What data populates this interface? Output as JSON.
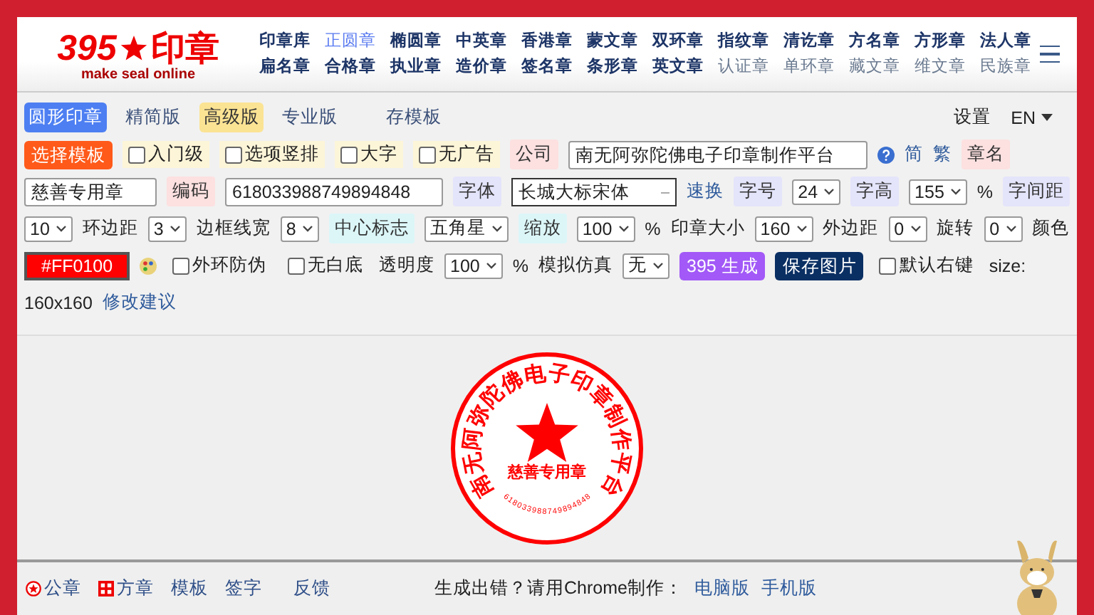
{
  "logo": {
    "number": "395",
    "title": "印章",
    "subtitle": "make seal online"
  },
  "nav": [
    [
      {
        "label": "印章库",
        "selected": false,
        "dimmed": false
      },
      {
        "label": "正圆章",
        "selected": true,
        "dimmed": false
      },
      {
        "label": "椭圆章",
        "selected": false,
        "dimmed": false
      },
      {
        "label": "中英章",
        "selected": false,
        "dimmed": false
      },
      {
        "label": "香港章",
        "selected": false,
        "dimmed": false
      },
      {
        "label": "蒙文章",
        "selected": false,
        "dimmed": false
      },
      {
        "label": "双环章",
        "selected": false,
        "dimmed": false
      },
      {
        "label": "指纹章",
        "selected": false,
        "dimmed": false
      },
      {
        "label": "清讫章",
        "selected": false,
        "dimmed": false
      },
      {
        "label": "方名章",
        "selected": false,
        "dimmed": false
      },
      {
        "label": "方形章",
        "selected": false,
        "dimmed": false
      },
      {
        "label": "法人章",
        "selected": false,
        "dimmed": false
      }
    ],
    [
      {
        "label": "扁名章",
        "selected": false,
        "dimmed": false
      },
      {
        "label": "合格章",
        "selected": false,
        "dimmed": false
      },
      {
        "label": "执业章",
        "selected": false,
        "dimmed": false
      },
      {
        "label": "造价章",
        "selected": false,
        "dimmed": false
      },
      {
        "label": "签名章",
        "selected": false,
        "dimmed": false
      },
      {
        "label": "条形章",
        "selected": false,
        "dimmed": false
      },
      {
        "label": "英文章",
        "selected": false,
        "dimmed": false
      },
      {
        "label": "认证章",
        "selected": false,
        "dimmed": true
      },
      {
        "label": "单环章",
        "selected": false,
        "dimmed": true
      },
      {
        "label": "藏文章",
        "selected": false,
        "dimmed": true
      },
      {
        "label": "维文章",
        "selected": false,
        "dimmed": true
      },
      {
        "label": "民族章",
        "selected": false,
        "dimmed": true
      }
    ]
  ],
  "modes": [
    {
      "label": "圆形印章",
      "kind": "active"
    },
    {
      "label": "精简版",
      "kind": "plain"
    },
    {
      "label": "高级版",
      "kind": "highlight"
    },
    {
      "label": "专业版",
      "kind": "plain"
    },
    {
      "label": "存模板",
      "kind": "plain"
    }
  ],
  "settings": "设置",
  "language": "EN",
  "rows": [
    [
      {
        "kind": "button",
        "label": "选择模板",
        "color": "#ff5a1a"
      },
      {
        "kind": "check",
        "label": "入门级",
        "checked": false
      },
      {
        "kind": "check",
        "label": "选项竖排",
        "checked": false
      },
      {
        "kind": "check",
        "label": "大字",
        "checked": false
      },
      {
        "kind": "check",
        "label": "无广告",
        "checked": false
      },
      {
        "kind": "tag",
        "label": "公司",
        "color": "#fde0e0"
      },
      {
        "kind": "input",
        "value": "南无阿弥陀佛电子印章制作平台"
      },
      {
        "kind": "help"
      },
      {
        "kind": "link",
        "label": "简"
      },
      {
        "kind": "link",
        "label": "繁"
      },
      {
        "kind": "tag",
        "label": "章名",
        "color": "#fde0e0"
      }
    ],
    [
      {
        "kind": "input",
        "value": "慈善专用章"
      },
      {
        "kind": "tag",
        "label": "编码",
        "color": "#fde0e0"
      },
      {
        "kind": "input",
        "value": "618033988749894848"
      },
      {
        "kind": "tag",
        "label": "字体",
        "color": "#e4e4fb"
      },
      {
        "kind": "combo",
        "value": "长城大标宋体"
      },
      {
        "kind": "link",
        "label": "速换"
      },
      {
        "kind": "tag",
        "label": "字号",
        "color": "#e4e4fb"
      },
      {
        "kind": "select",
        "value": "24"
      },
      {
        "kind": "tag",
        "label": "字高",
        "color": "#e4e4fb"
      },
      {
        "kind": "select",
        "value": "155"
      },
      {
        "kind": "text",
        "label": "%"
      },
      {
        "kind": "tag",
        "label": "字间距",
        "color": "#e4e4fb"
      }
    ],
    [
      {
        "kind": "select",
        "value": "10"
      },
      {
        "kind": "text",
        "label": "环边距"
      },
      {
        "kind": "select",
        "value": "3"
      },
      {
        "kind": "text",
        "label": "边框线宽"
      },
      {
        "kind": "select",
        "value": "8"
      },
      {
        "kind": "tag",
        "label": "中心标志",
        "color": "#dcf6f8"
      },
      {
        "kind": "select",
        "value": "五角星"
      },
      {
        "kind": "tag",
        "label": "缩放",
        "color": "#dcf6f8"
      },
      {
        "kind": "select",
        "value": "100"
      },
      {
        "kind": "text",
        "label": "%"
      },
      {
        "kind": "text",
        "label": "印章大小"
      },
      {
        "kind": "select",
        "value": "160"
      },
      {
        "kind": "text",
        "label": "外边距"
      },
      {
        "kind": "select",
        "value": "0"
      },
      {
        "kind": "text",
        "label": "旋转"
      },
      {
        "kind": "select",
        "value": "0"
      },
      {
        "kind": "text",
        "label": "颜色"
      }
    ],
    [
      {
        "kind": "swatch",
        "value": "#FF0100",
        "color": "#ff0100"
      },
      {
        "kind": "palette"
      },
      {
        "kind": "check",
        "label": "外环防伪",
        "checked": false
      },
      {
        "kind": "check",
        "label": "无白底",
        "checked": false
      },
      {
        "kind": "text",
        "label": "透明度"
      },
      {
        "kind": "select",
        "value": "100"
      },
      {
        "kind": "text",
        "label": "%"
      },
      {
        "kind": "text",
        "label": "模拟仿真"
      },
      {
        "kind": "select",
        "value": "无"
      },
      {
        "kind": "button",
        "label": "395 生成",
        "color": "#a259f7"
      },
      {
        "kind": "button",
        "label": "保存图片",
        "color": "#0a2f63"
      },
      {
        "kind": "check",
        "label": "默认右键",
        "checked": false
      },
      {
        "kind": "text",
        "label": "size:"
      }
    ],
    [
      {
        "kind": "text",
        "label": "160x160"
      },
      {
        "kind": "link",
        "label": "修改建议"
      }
    ]
  ],
  "stamp": {
    "ring_characters": [
      "南",
      "无",
      "阿",
      "弥",
      "陀",
      "佛",
      "电",
      "子",
      "印",
      "章",
      "制",
      "作",
      "平",
      "台"
    ],
    "name": "慈善专用章",
    "code_characters": [
      "6",
      "1",
      "8",
      "0",
      "3",
      "3",
      "9",
      "8",
      "8",
      "7",
      "4",
      "9",
      "8",
      "9",
      "4",
      "8",
      "4",
      "8"
    ]
  },
  "footer": {
    "links": [
      {
        "label": "公章"
      },
      {
        "label": "方章"
      },
      {
        "label": "模板"
      },
      {
        "label": "签字"
      },
      {
        "label": "反馈"
      }
    ],
    "notice": "生成出错？请用Chrome制作：",
    "versions": [
      "电脑版",
      "手机版"
    ]
  }
}
